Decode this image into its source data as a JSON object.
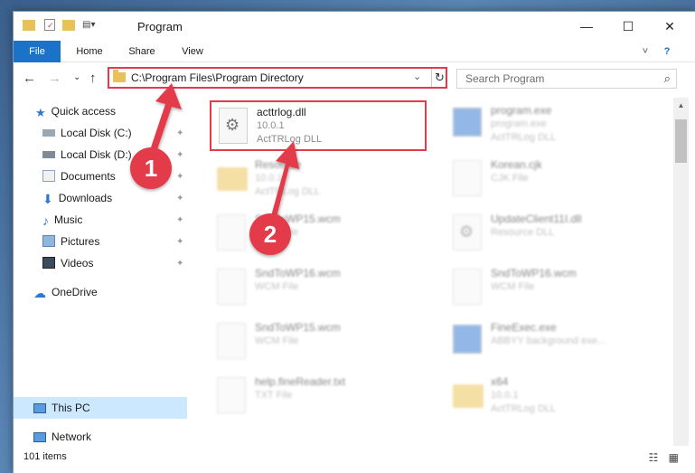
{
  "window": {
    "title": "Program",
    "minimize": "—",
    "maximize": "☐",
    "close": "✕"
  },
  "ribbon": {
    "tabs": [
      "File",
      "Home",
      "Share",
      "View"
    ],
    "collapse": "˅",
    "help": "?"
  },
  "address": {
    "path": "C:\\Program Files\\Program Directory",
    "dropdown": "⌄",
    "refresh": "↻"
  },
  "search": {
    "placeholder": "Search Program",
    "icon": "⌕"
  },
  "nav": {
    "back": "←",
    "forward": "→",
    "recent": "⌄",
    "up": "↑"
  },
  "sidebar": {
    "items": [
      {
        "label": "Quick access",
        "icon": "star-icon"
      },
      {
        "label": "Local Disk (C:)",
        "icon": "drive-icon",
        "pinned": true
      },
      {
        "label": "Local Disk (D:)",
        "icon": "drive-icon",
        "pinned": true
      },
      {
        "label": "Documents",
        "icon": "documents-icon",
        "pinned": true
      },
      {
        "label": "Downloads",
        "icon": "download-icon",
        "pinned": true
      },
      {
        "label": "Music",
        "icon": "music-icon",
        "pinned": true
      },
      {
        "label": "Pictures",
        "icon": "pictures-icon",
        "pinned": true
      },
      {
        "label": "Videos",
        "icon": "videos-icon",
        "pinned": true
      },
      {
        "label": "OneDrive",
        "icon": "cloud-icon"
      },
      {
        "label": "This PC",
        "icon": "computer-icon",
        "selected": true
      },
      {
        "label": "Network",
        "icon": "network-icon"
      }
    ],
    "pin_glyph": "📌"
  },
  "files": [
    {
      "name": "acttrlog.dll",
      "line2": "10.0.1",
      "line3": "ActTRLog DLL",
      "type": "dll",
      "highlight": true
    },
    {
      "name": "program.exe",
      "line2": "program.exe",
      "line3": "ActTRLog DLL",
      "type": "app"
    },
    {
      "name": "Resource",
      "line2": "10.0.1",
      "line3": "ActTRLog DLL",
      "type": "folder"
    },
    {
      "name": "Korean.cjk",
      "line2": "CJK File",
      "line3": "",
      "type": "blank"
    },
    {
      "name": "SndToWP15.wcm",
      "line2": "WCM File",
      "line3": "",
      "type": "blank"
    },
    {
      "name": "UpdateClient11I.dll",
      "line2": "Resource DLL",
      "line3": "",
      "type": "dll"
    },
    {
      "name": "SndToWP16.wcm",
      "line2": "WCM File",
      "line3": "",
      "type": "blank"
    },
    {
      "name": "SndToWP16.wcm",
      "line2": "WCM File",
      "line3": "",
      "type": "blank"
    },
    {
      "name": "SndToWP15.wcm",
      "line2": "WCM File",
      "line3": "",
      "type": "blank"
    },
    {
      "name": "FineExec.exe",
      "line2": "ABBYY background exe...",
      "line3": "",
      "type": "app"
    },
    {
      "name": "help.fineReader.txt",
      "line2": "TXT File",
      "line3": "",
      "type": "blank"
    },
    {
      "name": "x64",
      "line2": "10.0.1",
      "line3": "ActTRLog DLL",
      "type": "folder"
    }
  ],
  "status": {
    "count": "101 items",
    "view_icons": "☷ ▦"
  },
  "annotations": [
    "1",
    "2"
  ],
  "colors": {
    "accent": "#1a73c9",
    "highlight_red": "#e33b4a",
    "selection": "#cce8ff"
  }
}
